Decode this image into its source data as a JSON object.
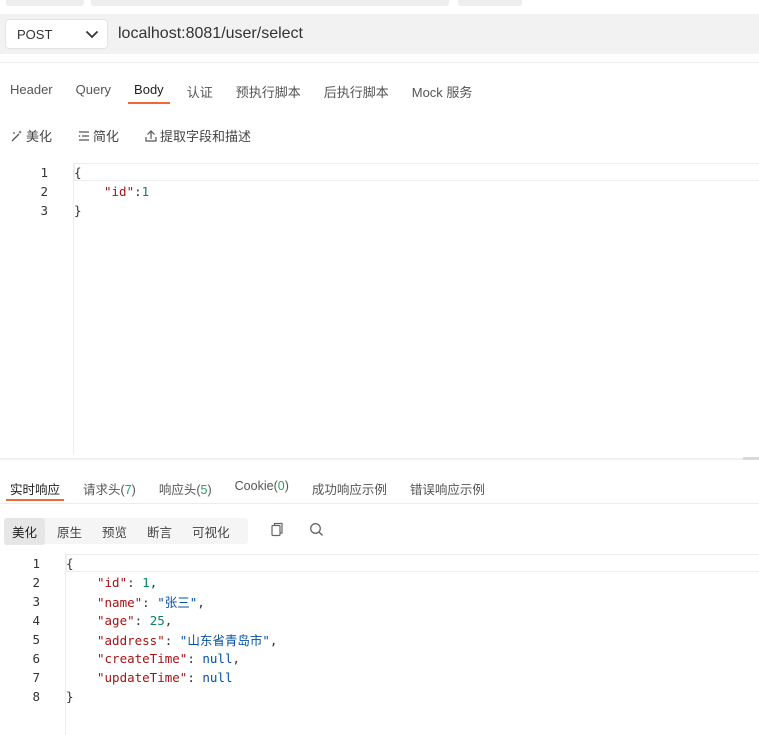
{
  "request": {
    "method": "POST",
    "url": "localhost:8081/user/select"
  },
  "tabs": [
    {
      "label": "Header"
    },
    {
      "label": "Query"
    },
    {
      "label": "Body",
      "active": true
    },
    {
      "label": "认证"
    },
    {
      "label": "预执行脚本"
    },
    {
      "label": "后执行脚本"
    },
    {
      "label": "Mock 服务"
    }
  ],
  "body_tools": {
    "beautify": "美化",
    "simplify": "简化",
    "extract": "提取字段和描述"
  },
  "request_body": {
    "line_numbers": [
      "1",
      "2",
      "3"
    ],
    "lines": [
      "{",
      "\"id\"",
      ":",
      "1",
      "}"
    ]
  },
  "response_tabs": {
    "realtime": "实时响应",
    "req_headers": "请求头",
    "req_headers_count": "7",
    "resp_headers": "响应头",
    "resp_headers_count": "5",
    "cookie": "Cookie",
    "cookie_count": "0",
    "success_example": "成功响应示例",
    "error_example": "错误响应示例"
  },
  "view_modes": [
    "美化",
    "原生",
    "预览",
    "断言",
    "可视化"
  ],
  "view_icons": [
    "copy-icon",
    "search-icon"
  ],
  "response_body": {
    "line_numbers": [
      "1",
      "2",
      "3",
      "4",
      "5",
      "6",
      "7",
      "8"
    ],
    "open": "{",
    "close": "}",
    "fields": [
      {
        "key": "\"id\"",
        "value": "1",
        "type": "number",
        "comma": ","
      },
      {
        "key": "\"name\"",
        "value": "\"张三\"",
        "type": "string",
        "comma": ","
      },
      {
        "key": "\"age\"",
        "value": "25",
        "type": "number",
        "comma": ","
      },
      {
        "key": "\"address\"",
        "value": "\"山东省青岛市\"",
        "type": "string",
        "comma": ","
      },
      {
        "key": "\"createTime\"",
        "value": "null",
        "type": "null",
        "comma": ","
      },
      {
        "key": "\"updateTime\"",
        "value": "null",
        "type": "null",
        "comma": ""
      }
    ]
  },
  "colors": {
    "accent": "#f0673a",
    "count_green": "#21a366",
    "json_key": "#a31515",
    "json_number": "#098658",
    "json_string": "#0451a5"
  }
}
